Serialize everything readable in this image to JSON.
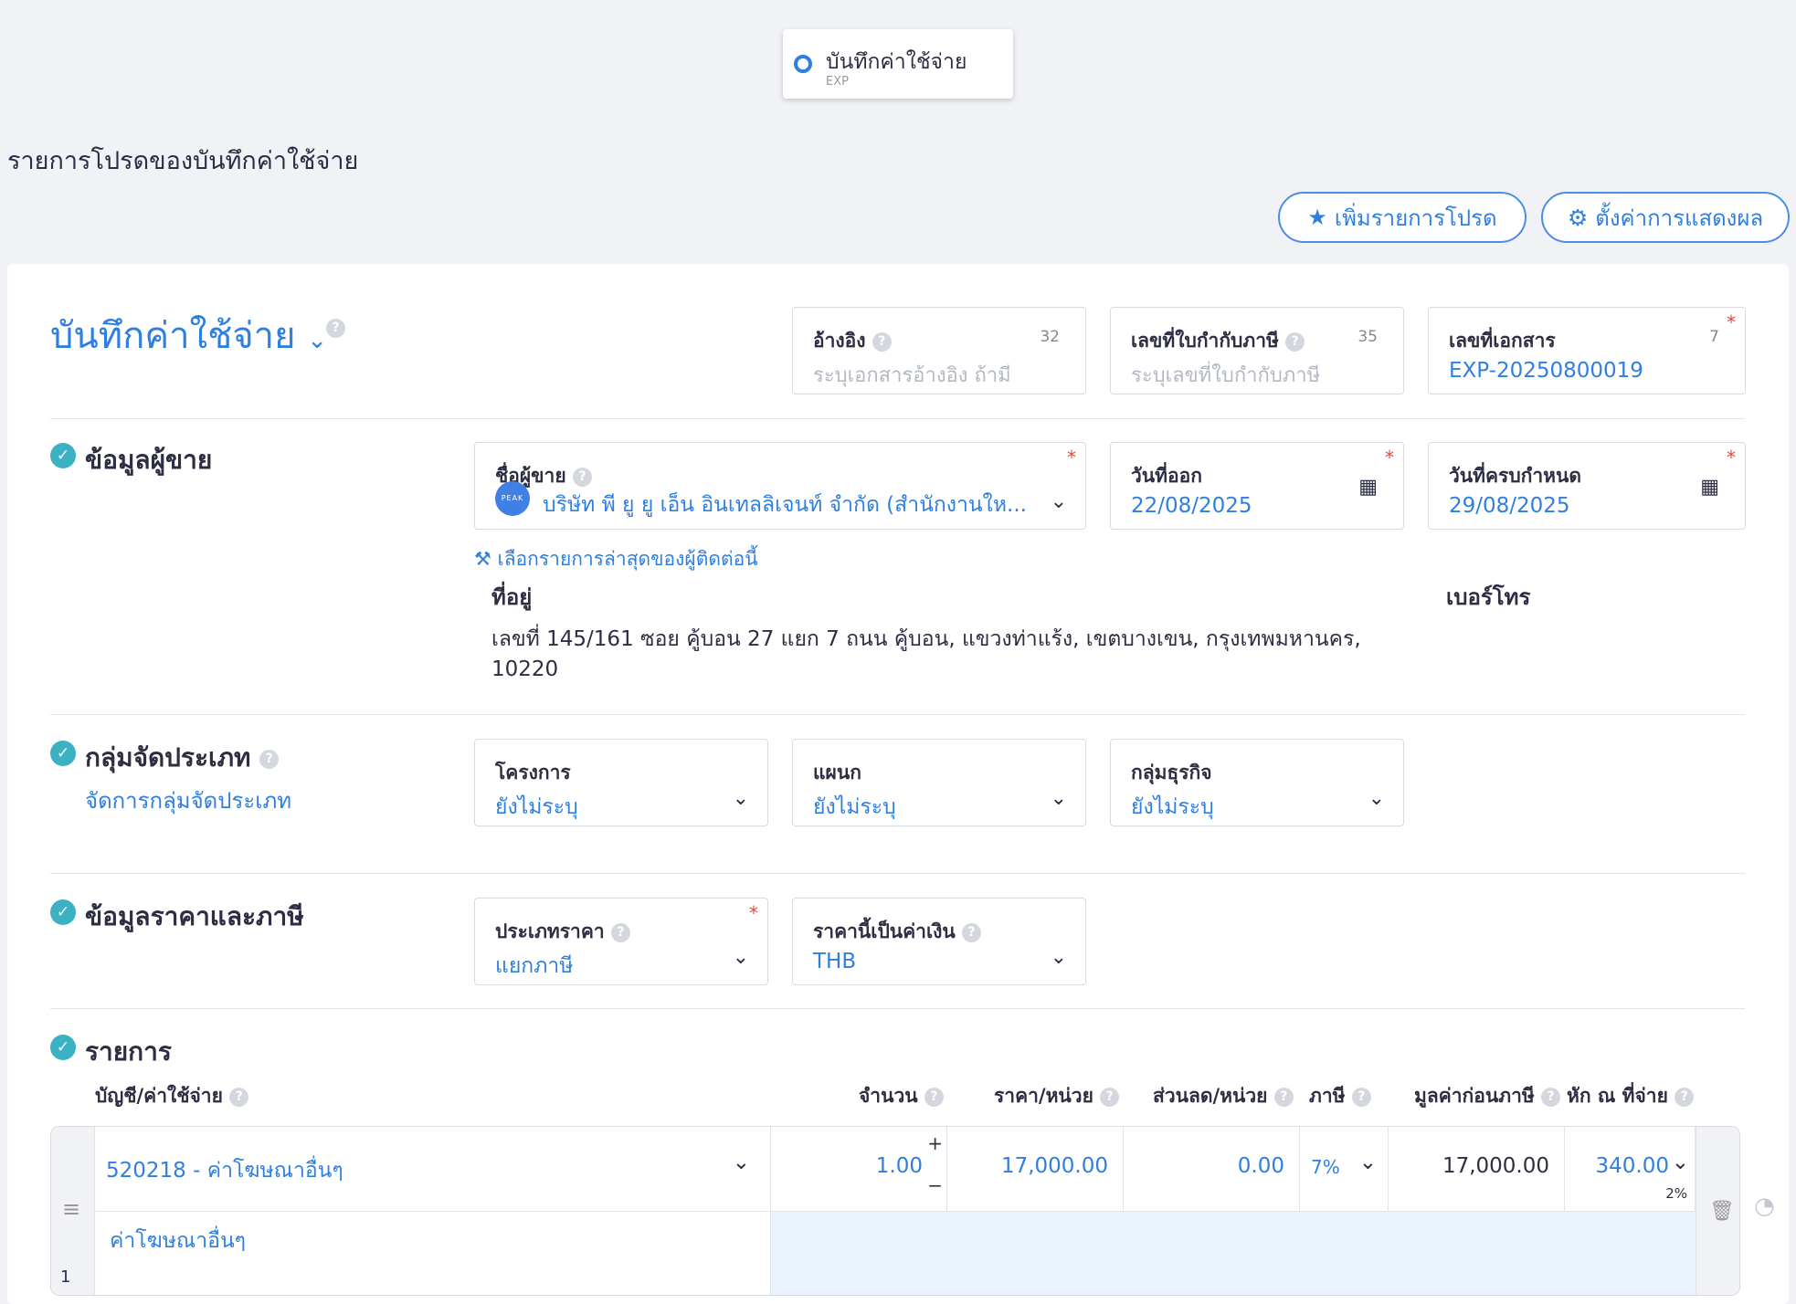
{
  "status_pill": {
    "label": "บันทึกค่าใช้จ่าย",
    "code": "EXP"
  },
  "favorites": {
    "title": "รายการโปรดของบันทึกค่าใช้จ่าย",
    "add_favorite": "เพิ่มรายการโปรด",
    "display_settings": "ตั้งค่าการแสดงผล"
  },
  "doc": {
    "title": "บันทึกค่าใช้จ่าย",
    "reference": {
      "label": "อ้างอิง",
      "placeholder": "ระบุเอกสารอ้างอิง ถ้ามี",
      "counter": "32"
    },
    "tax_invoice": {
      "label": "เลขที่ใบกำกับภาษี",
      "placeholder": "ระบุเลขที่ใบกำกับภาษี",
      "counter": "35"
    },
    "doc_number": {
      "label": "เลขที่เอกสาร",
      "value": "EXP-20250800019",
      "counter": "7"
    }
  },
  "vendor": {
    "section_title": "ข้อมูลผู้ขาย",
    "name_label": "ชื่อผู้ขาย",
    "name_value": "บริษัท พี ยู ยู เอ็น อินเทลลิเจนท์ จำกัด (สำนักงานให...",
    "avatar_text": "PEAK",
    "issue_date_label": "วันที่ออก",
    "issue_date": "22/08/2025",
    "due_date_label": "วันที่ครบกำหนด",
    "due_date": "29/08/2025",
    "latest_link": "เลือกรายการล่าสุดของผู้ติดต่อนี้",
    "address_label": "ที่อยู่",
    "address_line1": "เลขที่ 145/161 ซอย คู้บอน 27 แยก 7 ถนน คู้บอน, แขวงท่าแร้ง, เขตบางเขน, กรุงเทพมหานคร,",
    "address_line2": "10220",
    "phone_label": "เบอร์โทร"
  },
  "classification": {
    "section_title": "กลุ่มจัดประเภท",
    "manage_link": "จัดการกลุ่มจัดประเภท",
    "project_label": "โครงการ",
    "project_value": "ยังไม่ระบุ",
    "department_label": "แผนก",
    "department_value": "ยังไม่ระบุ",
    "business_label": "กลุ่มธุรกิจ",
    "business_value": "ยังไม่ระบุ"
  },
  "pricing": {
    "section_title": "ข้อมูลราคาและภาษี",
    "price_type_label": "ประเภทราคา",
    "price_type_value": "แยกภาษี",
    "currency_label": "ราคานี้เป็นค่าเงิน",
    "currency_value": "THB"
  },
  "items": {
    "section_title": "รายการ",
    "headers": {
      "account": "บัญชี/ค่าใช้จ่าย",
      "qty": "จำนวน",
      "unit_price": "ราคา/หน่วย",
      "discount": "ส่วนลด/หน่วย",
      "tax": "ภาษี",
      "pre_tax": "มูลค่าก่อนภาษี",
      "withholding": "หัก ณ ที่จ่าย"
    },
    "rows": [
      {
        "account": "520218 - ค่าโฆษณาอื่นๆ",
        "description": "ค่าโฆษณาอื่นๆ",
        "qty": "1.00",
        "unit_price": "17,000.00",
        "discount": "0.00",
        "tax": "7%",
        "pre_tax": "17,000.00",
        "withholding": "340.00",
        "withholding_rate": "2%",
        "index": "1"
      }
    ]
  }
}
